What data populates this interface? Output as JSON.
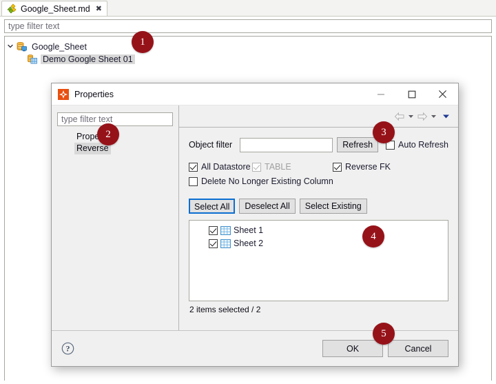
{
  "background": {
    "tab": {
      "label": "Google_Sheet.md",
      "icon": "puzzle-icon",
      "close_icon": "close-icon"
    },
    "filter": {
      "placeholder": "type filter text",
      "value": ""
    },
    "tree": [
      {
        "label": "Google_Sheet",
        "icon": "database-icon",
        "twisty": "⌄",
        "selected": false
      },
      {
        "label": "Demo Google Sheet 01",
        "icon": "datastore-icon",
        "selected": true
      }
    ]
  },
  "dialog": {
    "title": "Properties",
    "app_icon": "odi-icon",
    "window_controls": {
      "minimize": "minimize-icon",
      "maximize": "maximize-icon",
      "close": "close-icon"
    },
    "left_panel": {
      "filter_placeholder": "type filter text",
      "nav_items": [
        {
          "label": "Properties",
          "selected": false
        },
        {
          "label": "Reverse",
          "selected": true
        }
      ]
    },
    "toolbar": {
      "back_icon": "arrow-left-icon",
      "back_menu_icon": "caret-down-icon",
      "forward_icon": "arrow-right-icon",
      "forward_menu_icon": "caret-down-icon",
      "view_menu_icon": "caret-down-filled-icon"
    },
    "object_filter": {
      "label": "Object filter",
      "value": "",
      "placeholder": ""
    },
    "refresh_button": "Refresh",
    "auto_refresh": {
      "label": "Auto Refresh",
      "checked": false,
      "enabled": true
    },
    "checkboxes": [
      {
        "label": "All Datastore",
        "checked": true,
        "enabled": true
      },
      {
        "label": "TABLE",
        "checked": true,
        "enabled": false
      },
      {
        "label": "Reverse FK",
        "checked": true,
        "enabled": true
      },
      {
        "label": "Delete No Longer Existing Column",
        "checked": false,
        "enabled": true
      }
    ],
    "selection_buttons": [
      {
        "label": "Select All",
        "focused": true
      },
      {
        "label": "Deselect All",
        "focused": false
      },
      {
        "label": "Select Existing",
        "focused": false
      }
    ],
    "sheet_list": [
      {
        "label": "Sheet 1",
        "checked": true,
        "icon": "table-icon"
      },
      {
        "label": "Sheet 2",
        "checked": true,
        "icon": "table-icon"
      }
    ],
    "list_status": "2 items selected / 2",
    "help_icon": "help-icon",
    "ok_button": "OK",
    "cancel_button": "Cancel"
  },
  "annotations": [
    {
      "number": "1"
    },
    {
      "number": "2"
    },
    {
      "number": "3"
    },
    {
      "number": "4"
    },
    {
      "number": "5"
    }
  ],
  "colors": {
    "badge": "#961219",
    "focus_border": "#0a6ed1",
    "dialog_bg": "#f0f0f0",
    "selection_bg": "#d8d8d8"
  }
}
